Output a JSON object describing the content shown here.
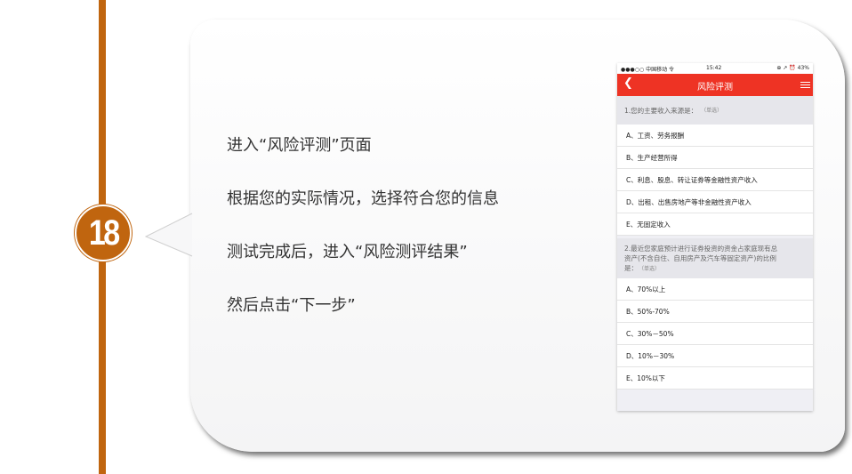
{
  "step_number": "18",
  "instructions": [
    "进入“风险评测”页面",
    "根据您的实际情况，选择符合您的信息",
    "测试完成后，进入“风险测评结果”",
    "然后点击“下一步”"
  ],
  "phone": {
    "status": {
      "carrier": "●●●○○ 中国移动 令",
      "time": "15:42",
      "right": "⊕ ↗ ⏰ 43%"
    },
    "nav_title": "风险评测",
    "questions": [
      {
        "text": "1.您的主要收入来源是：",
        "tag": "（单选）",
        "options": [
          "A、工资、劳务报酬",
          "B、生产经营所得",
          "C、利息、股息、转让证券等金融性资产收入",
          "D、出租、出售房地产等非金融性资产收入",
          "E、无固定收入"
        ]
      },
      {
        "text_line1": "2.最近您家庭预计进行证券投资的资金占家庭现有总",
        "text_line2": "资产(不含自住、自用房产及汽车等固定资产)的比例",
        "text_line3": "是：",
        "tag": "（单选）",
        "options": [
          "A、70%以上",
          "B、50%-70%",
          "C、30%－50%",
          "D、10%－30%",
          "E、10%以下"
        ]
      }
    ]
  }
}
